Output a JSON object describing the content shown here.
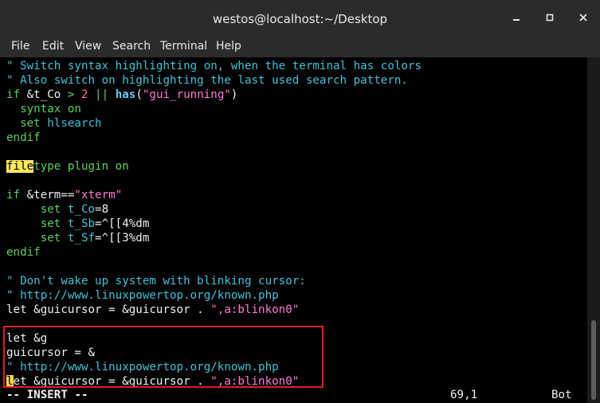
{
  "window": {
    "title": "westos@localhost:~/Desktop",
    "minimize_icon": "minimize-icon",
    "maximize_icon": "maximize-icon",
    "close_icon": "close-icon"
  },
  "menu": [
    "File",
    "Edit",
    "View",
    "Search",
    "Terminal",
    "Help"
  ],
  "editor": {
    "lines": {
      "l1": "\" Switch syntax highlighting on, when the terminal has colors",
      "l2": "\" Also switch on highlighting the last used search pattern.",
      "l3": {
        "a": "if ",
        "b": "&t_Co",
        "c": " > ",
        "d": "2",
        "e": " || ",
        "f": "has",
        "g": "(",
        "h": "\"gui_running\"",
        "i": ")"
      },
      "l4": {
        "a": "  syntax ",
        "b": "on"
      },
      "l5": {
        "a": "  set ",
        "b": "hlsearch"
      },
      "l6": "endif",
      "l8": {
        "a": "file",
        "b": "type ",
        "c": "plugin on"
      },
      "l10": {
        "a": "if ",
        "b": "&term==",
        "c": "\"xterm\""
      },
      "l11": {
        "a": "     set ",
        "b": "t_Co",
        "c": "=8"
      },
      "l12": {
        "a": "     set ",
        "b": "t_Sb",
        "c": "=^[[4%dm"
      },
      "l13": {
        "a": "     set ",
        "b": "t_Sf",
        "c": "=^[[3%dm"
      },
      "l14": "endif",
      "l16": "\" Don't wake up system with blinking cursor:",
      "l17": "\" http://www.linuxpowertop.org/known.php",
      "l18": {
        "a": "let &guicursor = &guicursor . ",
        "b": "\",a:blinkon0\""
      },
      "l20": "let &g",
      "l21": "guicursor = &",
      "l22": "\" http://www.linuxpowertop.org/known.php",
      "l23": {
        "a": "l",
        "b": "et &guicursor = &guicursor . ",
        "c": "\",a:blinkon0\""
      }
    },
    "status": {
      "mode": "-- INSERT --",
      "position": "69,1",
      "scroll": "Bot"
    }
  },
  "colors": {
    "comment": "#3ac3d8",
    "keyword": "#5ad05a",
    "string": "#ff77d6",
    "number": "#ff6b6b",
    "search_highlight": "#ffe75a",
    "annotation_box": "#e01c24"
  }
}
